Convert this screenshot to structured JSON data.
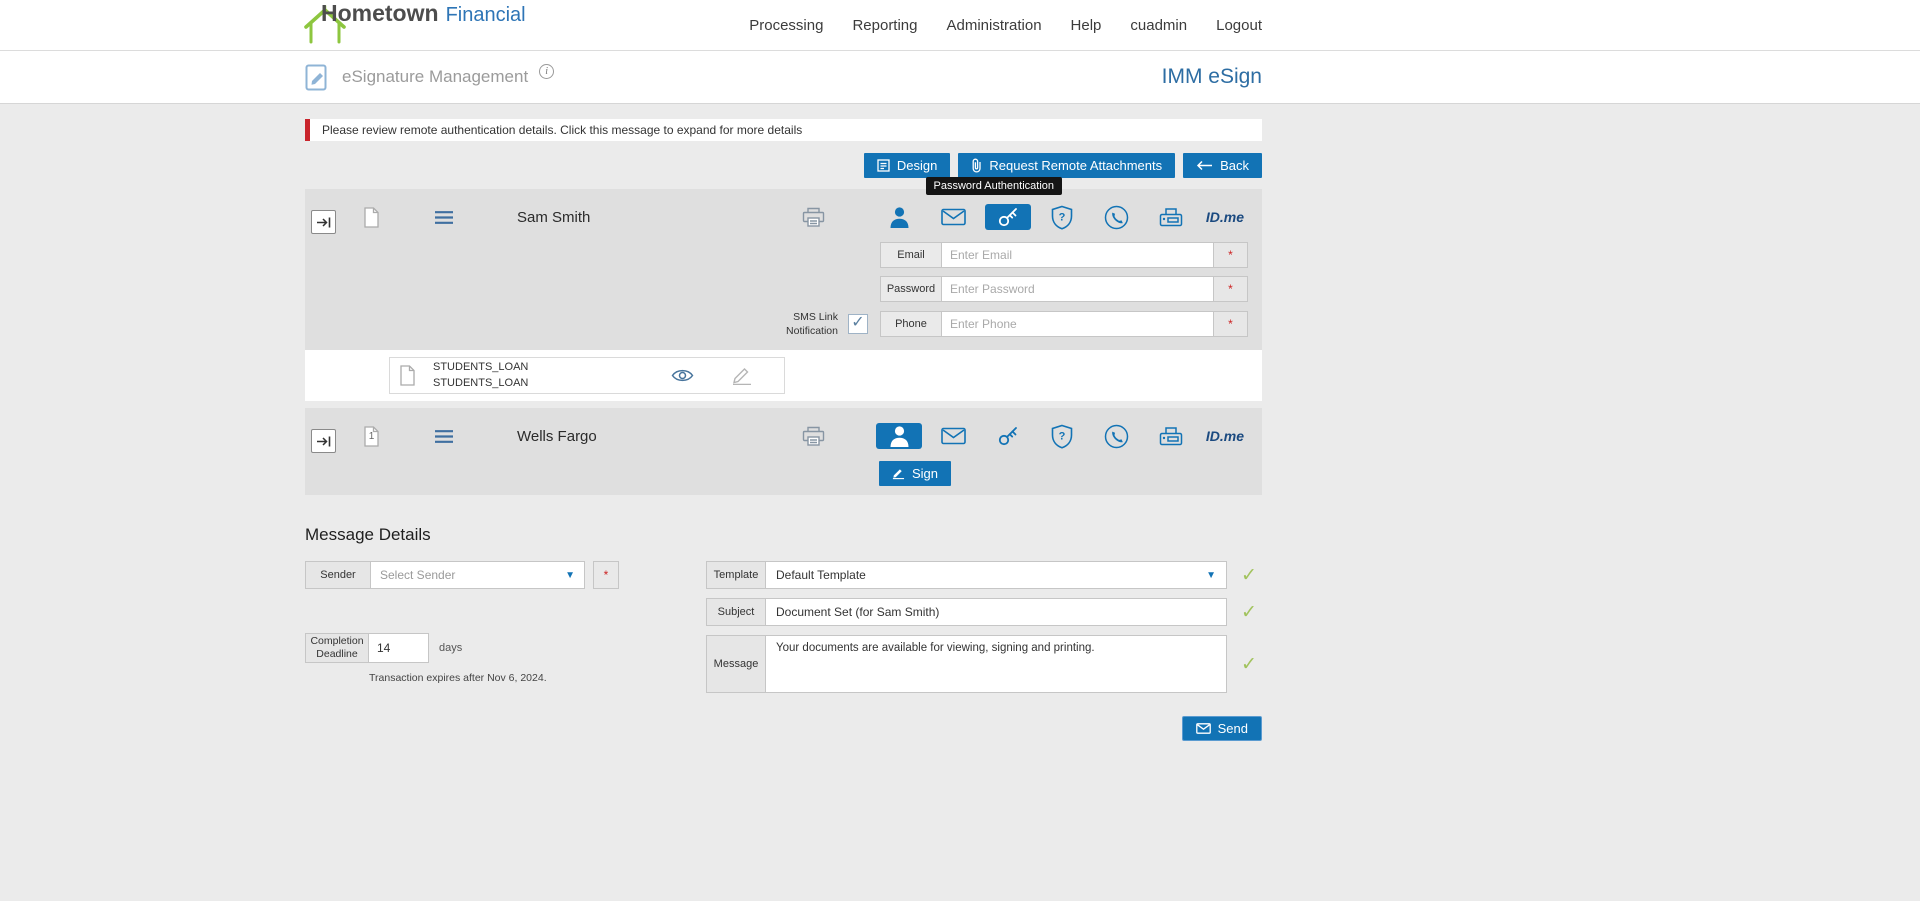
{
  "colors": {
    "accent_blue": "#1273b5",
    "brand_green": "#8dc63f",
    "brand_blue": "#2e75b6",
    "notice_red": "#c9252c",
    "check_green": "#a2c35e"
  },
  "topnav": {
    "brand_name": "Hometown",
    "brand_suffix": "Financial",
    "items": [
      {
        "label": "Processing"
      },
      {
        "label": "Reporting"
      },
      {
        "label": "Administration"
      },
      {
        "label": "Help"
      },
      {
        "label": "cuadmin"
      },
      {
        "label": "Logout"
      }
    ]
  },
  "header": {
    "title": "eSignature Management",
    "info_glyph": "i",
    "product": "IMM eSign"
  },
  "notice": {
    "text": "Please review remote authentication details. Click this message to expand for more details"
  },
  "toolbar": {
    "design": "Design",
    "request_attachments": "Request Remote Attachments",
    "back": "Back"
  },
  "tooltip": {
    "text": "Password Authentication"
  },
  "signers": [
    {
      "name": "Sam Smith",
      "idme": "ID.me",
      "fields": {
        "email_label": "Email",
        "email_placeholder": "Enter Email",
        "password_label": "Password",
        "password_placeholder": "Enter Password",
        "sms_label": "SMS Link Notification",
        "phone_label": "Phone",
        "phone_placeholder": "Enter Phone",
        "required_marker": "*"
      },
      "documents": [
        {
          "line1": "STUDENTS_LOAN",
          "line2": "STUDENTS_LOAN"
        }
      ]
    },
    {
      "name": "Wells Fargo",
      "idme": "ID.me",
      "doc_count": "1",
      "sign_button": "Sign"
    }
  ],
  "message_details": {
    "heading": "Message Details",
    "sender": {
      "label": "Sender",
      "value": "Select Sender",
      "required_marker": "*"
    },
    "deadline": {
      "label": "Completion Deadline",
      "value": "14",
      "unit": "days",
      "note": "Transaction expires after Nov 6, 2024."
    },
    "template": {
      "label": "Template",
      "value": "Default Template"
    },
    "subject": {
      "label": "Subject",
      "value": "Document Set (for Sam Smith)"
    },
    "message": {
      "label": "Message",
      "value": "Your documents are available for viewing, signing and printing."
    },
    "send": "Send"
  },
  "glyphs": {
    "check": "✓",
    "caret": "▼"
  }
}
